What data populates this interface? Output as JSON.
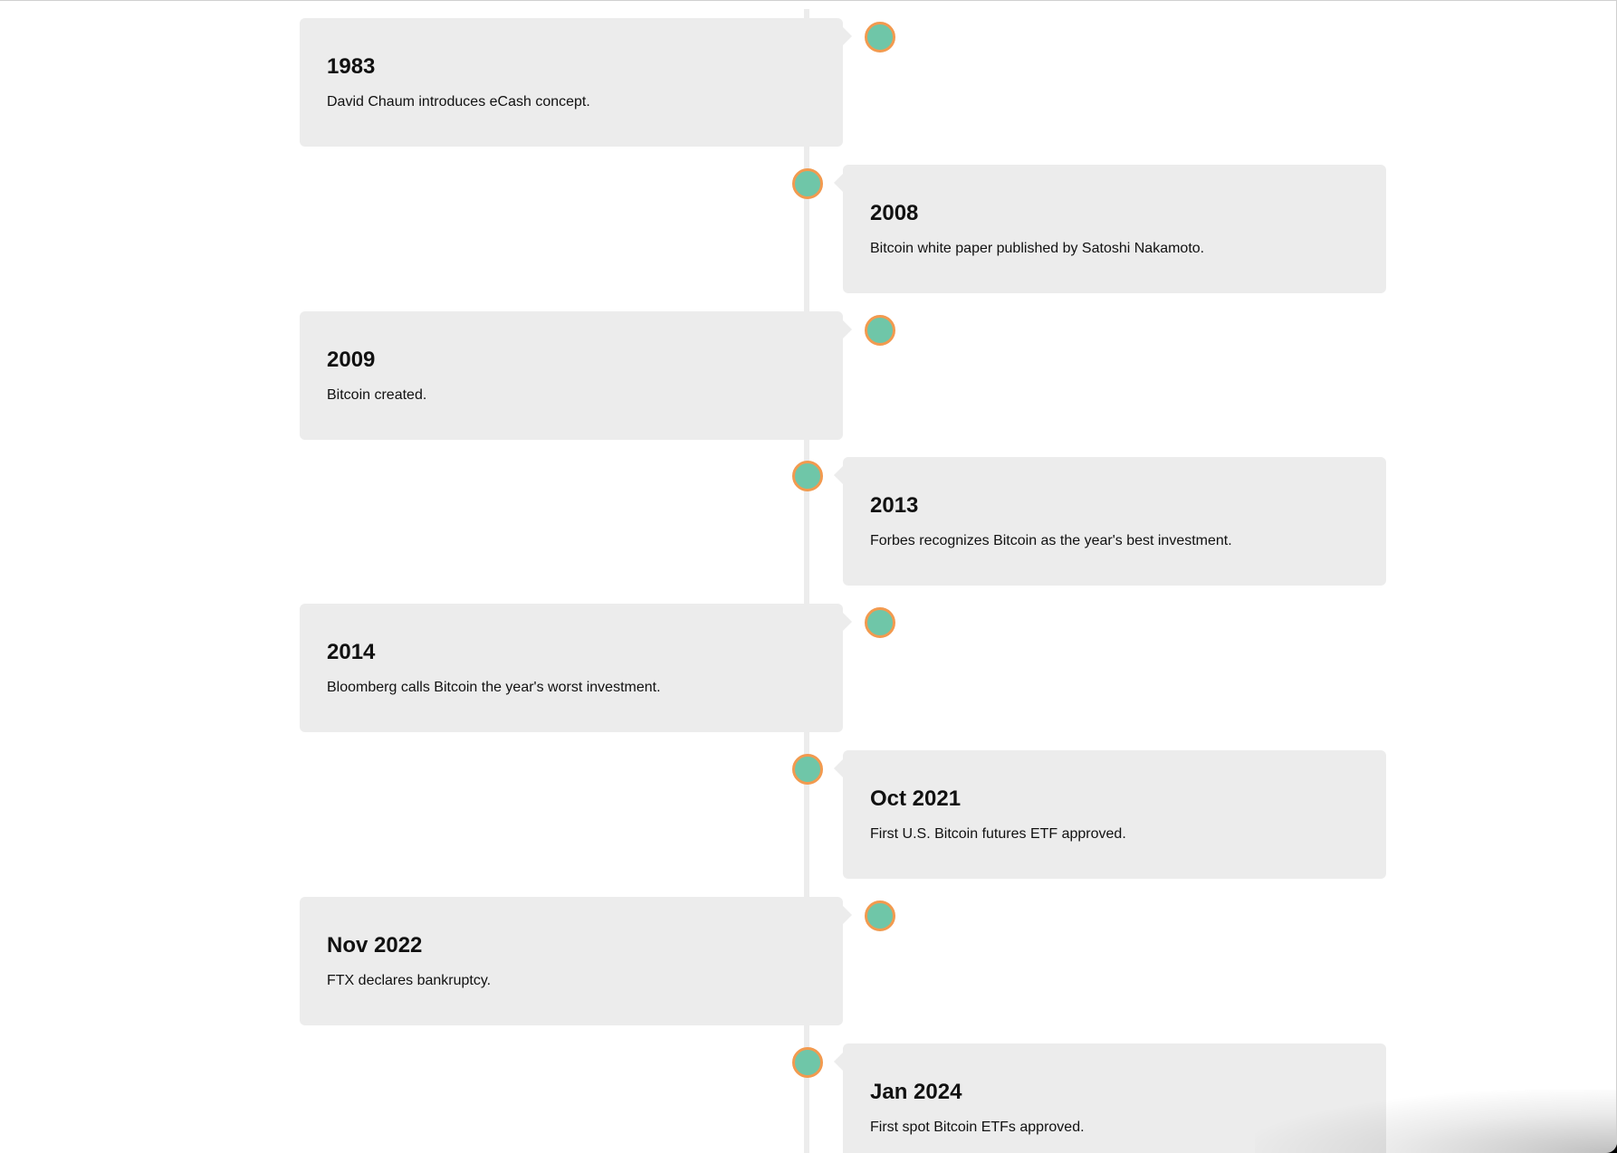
{
  "timeline": {
    "events": [
      {
        "title": "1983",
        "text": "David Chaum introduces eCash concept."
      },
      {
        "title": "2008",
        "text": "Bitcoin white paper published by Satoshi Nakamoto."
      },
      {
        "title": "2009",
        "text": "Bitcoin created."
      },
      {
        "title": "2013",
        "text": "Forbes recognizes Bitcoin as the year's best investment."
      },
      {
        "title": "2014",
        "text": "Bloomberg calls Bitcoin the year's worst investment."
      },
      {
        "title": "Oct 2021",
        "text": "First U.S. Bitcoin futures ETF approved."
      },
      {
        "title": "Nov 2022",
        "text": "FTX declares bankruptcy."
      },
      {
        "title": "Jan 2024",
        "text": "First spot Bitcoin ETFs approved."
      }
    ]
  },
  "colors": {
    "card_background": "#ececec",
    "timeline_line": "#ececec",
    "dot_fill": "#6fc6a8",
    "dot_border": "#f29a4f"
  }
}
